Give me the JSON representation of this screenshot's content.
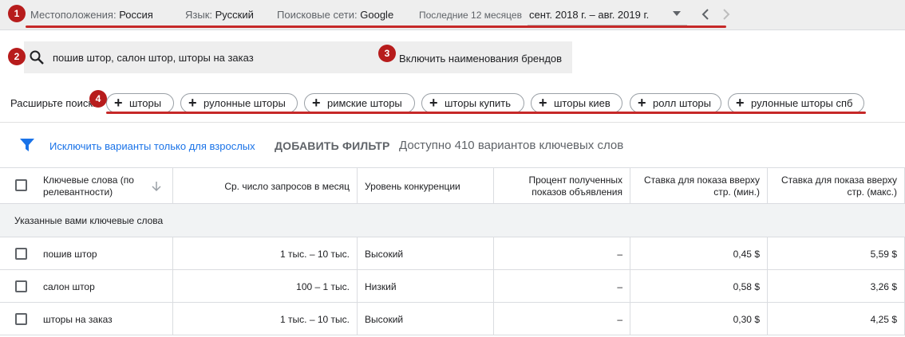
{
  "topbar": {
    "location_label": "Местоположения:",
    "location_value": "Россия",
    "language_label": "Язык:",
    "language_value": "Русский",
    "networks_label": "Поисковые сети:",
    "networks_value": "Google",
    "period_label": "Последние 12 месяцев",
    "period_value": "сент. 2018 г. – авг. 2019 г."
  },
  "annotations": [
    "1",
    "2",
    "3",
    "4"
  ],
  "search": {
    "query": "пошив штор, салон штор, шторы на заказ",
    "brand_toggle_label": "Включить наименования брендов"
  },
  "expand": {
    "label": "Расширьте поиск:",
    "chips": [
      "шторы",
      "рулонные шторы",
      "римские шторы",
      "шторы купить",
      "шторы киев",
      "ролл шторы",
      "рулонные шторы спб"
    ]
  },
  "filters": {
    "exclude_link": "Исключить варианты только для взрослых",
    "add_filter": "ДОБАВИТЬ ФИЛЬТР",
    "available": "Доступно 410 вариантов ключевых слов"
  },
  "table": {
    "headers": [
      "Ключевые слова (по релевантности)",
      "Ср. число запросов в месяц",
      "Уровень конкуренции",
      "Процент полученных показов объявления",
      "Ставка для показа вверху стр. (мин.)",
      "Ставка для показа вверху стр. (макс.)"
    ],
    "group_label": "Указанные вами ключевые слова",
    "rows": [
      {
        "keyword": "пошив штор",
        "searches": "1 тыс. – 10 тыс.",
        "competition": "Высокий",
        "impression_share": "–",
        "bid_low": "0,45 $",
        "bid_high": "5,59 $"
      },
      {
        "keyword": "салон штор",
        "searches": "100 – 1 тыс.",
        "competition": "Низкий",
        "impression_share": "–",
        "bid_low": "0,58 $",
        "bid_high": "3,26 $"
      },
      {
        "keyword": "шторы на заказ",
        "searches": "1 тыс. – 10 тыс.",
        "competition": "Высокий",
        "impression_share": "–",
        "bid_low": "0,30 $",
        "bid_high": "4,25 $"
      }
    ]
  },
  "colors": {
    "accent": "#1a73e8",
    "annotation_red": "#c62828",
    "bar_gray": "#eeeeee"
  }
}
